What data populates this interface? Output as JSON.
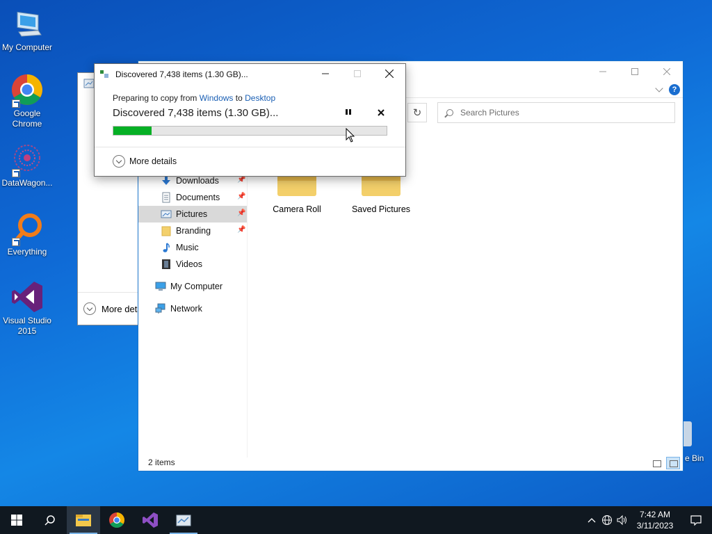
{
  "desktop": {
    "icons": [
      {
        "label": "My Computer",
        "icon": "computer-icon"
      },
      {
        "label": "Google Chrome",
        "icon": "chrome-icon"
      },
      {
        "label": "DataWagon...",
        "icon": "datawagon-icon"
      },
      {
        "label": "Everything",
        "icon": "everything-icon"
      },
      {
        "label": "Visual Studio 2015",
        "icon": "visual-studio-icon"
      }
    ],
    "recycle_bin_label": "e Bin"
  },
  "back_window": {
    "more_details": "More deta"
  },
  "explorer": {
    "search_placeholder": "Search Pictures",
    "help": "?",
    "nav": {
      "items": [
        {
          "label": "Downloads",
          "pinned": true
        },
        {
          "label": "Documents",
          "pinned": true
        },
        {
          "label": "Pictures",
          "pinned": true,
          "selected": true
        },
        {
          "label": "Branding",
          "pinned": true
        },
        {
          "label": "Music",
          "pinned": false
        },
        {
          "label": "Videos",
          "pinned": false
        },
        {
          "label": "My Computer",
          "pinned": false
        },
        {
          "label": "Network",
          "pinned": false
        }
      ]
    },
    "folders": [
      "Camera Roll",
      "Saved Pictures"
    ],
    "status": "2 items"
  },
  "copy_dialog": {
    "title": "Discovered 7,438 items (1.30 GB)...",
    "prep_prefix": "Preparing to copy from",
    "source": "Windows",
    "prep_mid": "to",
    "destination": "Desktop",
    "heading": "Discovered 7,438 items (1.30 GB)...",
    "progress": 0.14,
    "progress_color": "#06b025",
    "more_details": "More details"
  },
  "taskbar": {
    "apps": [
      "start-icon",
      "search-icon",
      "file-explorer-icon",
      "chrome-icon",
      "visual-studio-icon",
      "copy-progress-icon"
    ],
    "clock_time": "7:42 AM",
    "clock_date": "3/11/2023"
  }
}
